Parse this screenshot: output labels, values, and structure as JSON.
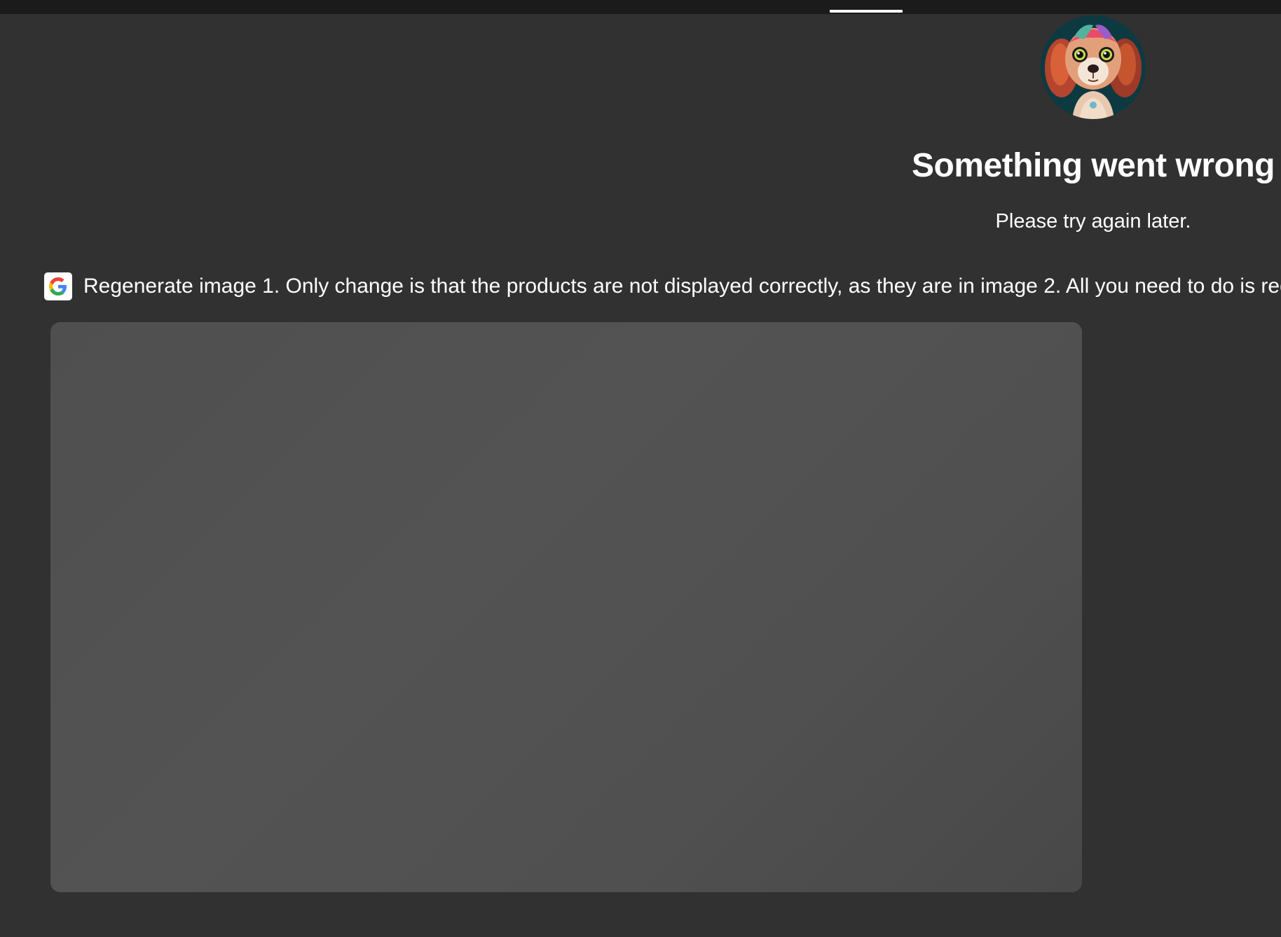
{
  "error": {
    "title": "Something went wrong",
    "message": "Please try again later."
  },
  "prompt": {
    "provider_icon": "google-g-icon",
    "text": "Regenerate image 1. Only change is that the products are not displayed correctly, as they are in image 2. All you need to do is regenerate"
  },
  "avatar": {
    "icon": "dog-avatar"
  },
  "colors": {
    "background": "#313131",
    "top_bar": "#1b1b1b",
    "placeholder": "#525252",
    "text": "#ffffff"
  }
}
